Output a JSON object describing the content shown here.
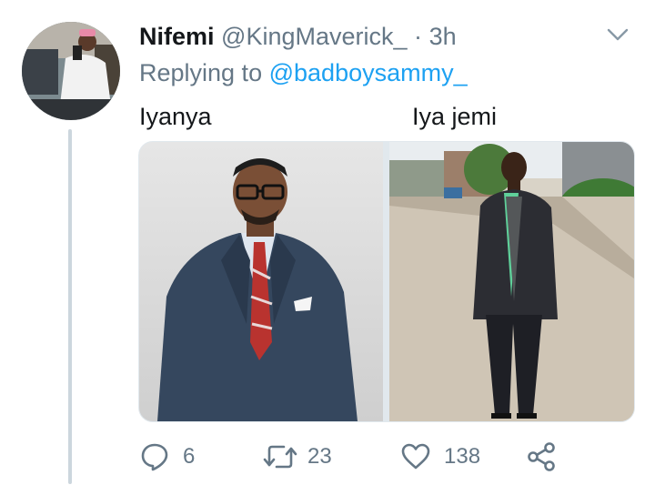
{
  "tweet": {
    "author_name": "Nifemi",
    "author_handle": "@KingMaverick_",
    "separator": "·",
    "time": "3h",
    "replying_prefix": "Replying to",
    "replying_to": "@badboysammy_",
    "text_left": "Iyanya",
    "text_right": "Iya jemi"
  },
  "media": {
    "left_photo": "man-in-navy-suit-studio-icon",
    "right_photo": "man-standing-outdoors-street-icon"
  },
  "actions": {
    "reply_count": "6",
    "retweet_count": "23",
    "like_count": "138"
  },
  "colors": {
    "text": "#14171a",
    "secondary": "#657786",
    "link": "#1da1f2",
    "thread_line": "#ccd6dd"
  }
}
